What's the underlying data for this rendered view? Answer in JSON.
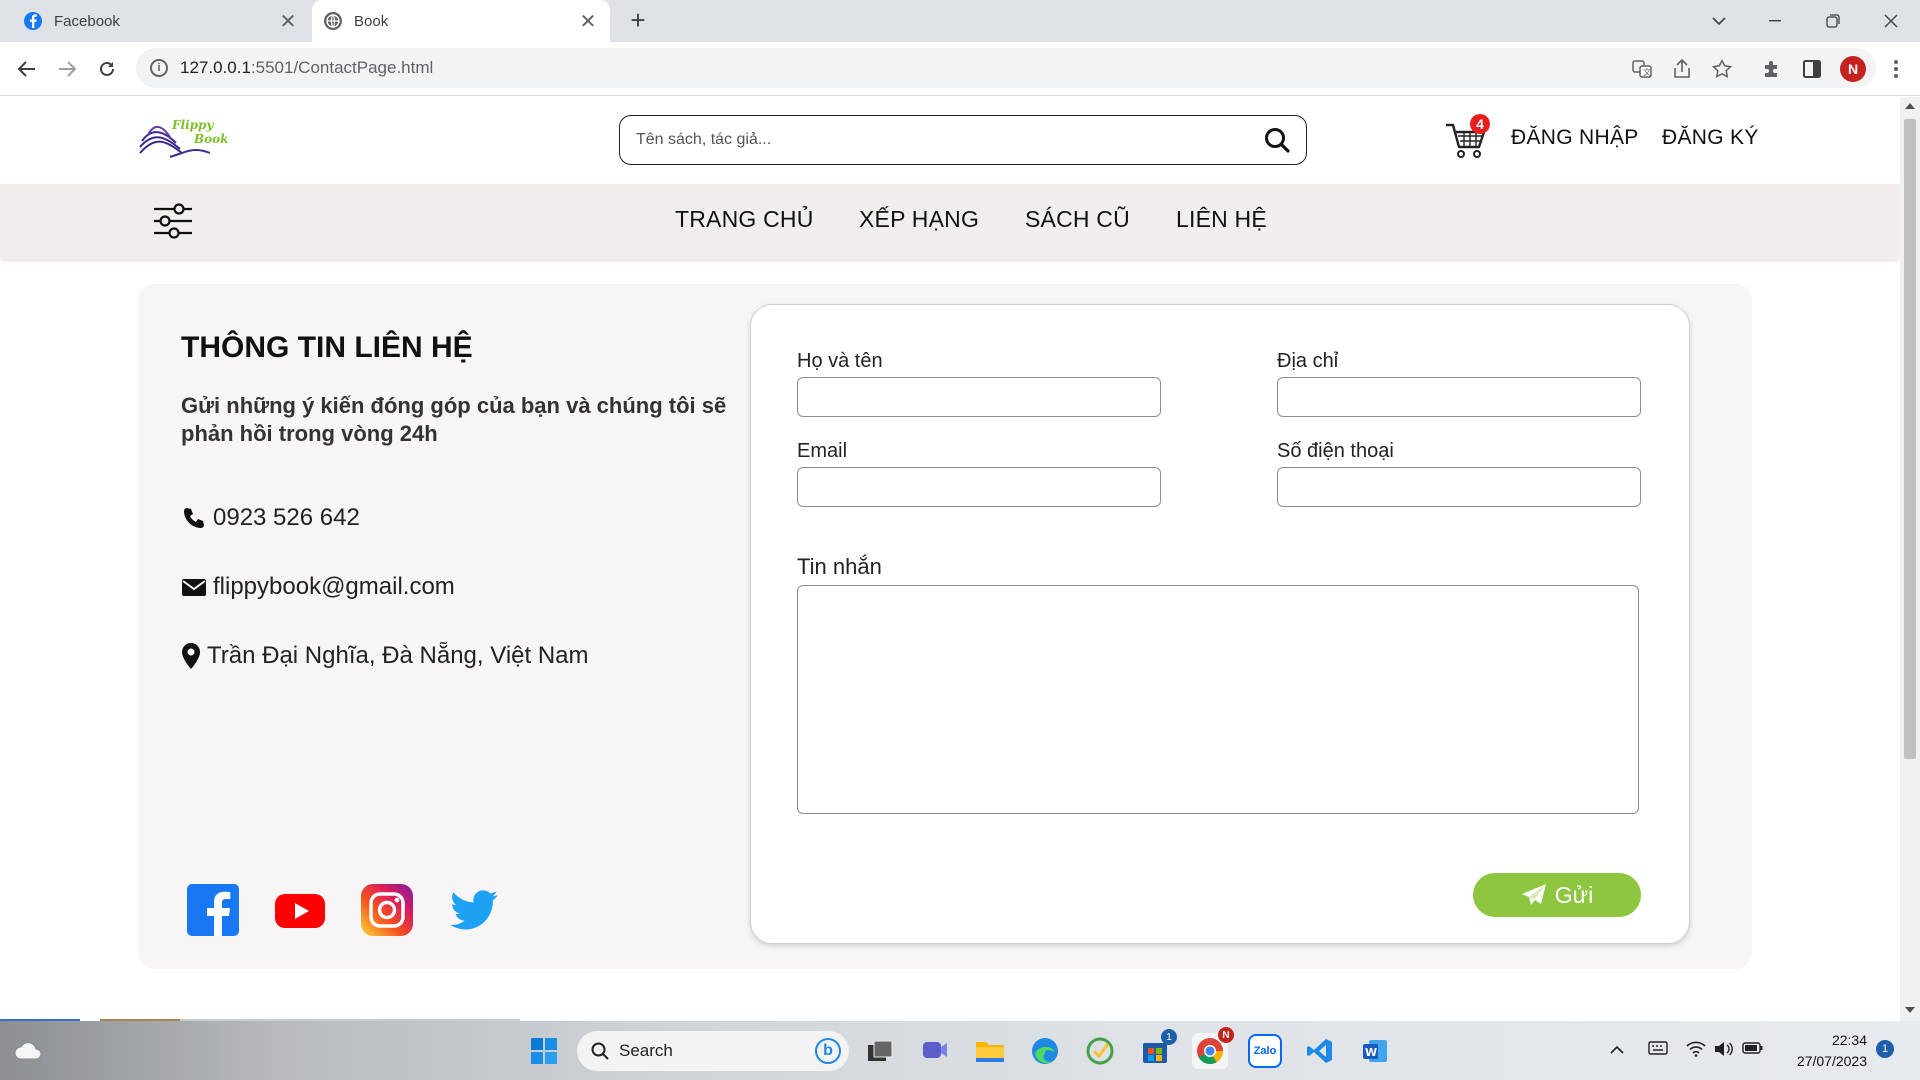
{
  "browser": {
    "tabs": [
      {
        "label": "Facebook",
        "close": "✕"
      },
      {
        "label": "Book",
        "close": "✕"
      }
    ],
    "new_tab": "+",
    "url_host": "127.0.0.1",
    "url_rest": ":5501/ContactPage.html",
    "profile_initial": "N"
  },
  "header": {
    "search_placeholder": "Tên sách, tác giả...",
    "cart_count": "4",
    "login": "ĐĂNG NHẬP",
    "register": "ĐĂNG KÝ",
    "logo_text": "Flippy Book"
  },
  "nav": {
    "items": [
      "TRANG CHỦ",
      "XẾP HẠNG",
      "SÁCH CŨ",
      "LIÊN HỆ"
    ]
  },
  "contact": {
    "title": "THÔNG TIN LIÊN HỆ",
    "description": "Gửi những ý kiến đóng góp của bạn và chúng tôi sẽ phản hồi trong vòng 24h",
    "phone": "0923 526 642",
    "email": "flippybook@gmail.com",
    "address": "Trần Đại Nghĩa, Đà Nẵng, Việt Nam"
  },
  "form": {
    "name_label": "Họ và tên",
    "address_label": "Địa chỉ",
    "email_label": "Email",
    "phone_label": "Số điện thoại",
    "message_label": "Tin nhắn",
    "send_label": "Gửi",
    "name_value": "",
    "address_value": "",
    "email_value": "",
    "phone_value": "",
    "message_value": ""
  },
  "taskbar": {
    "search_label": "Search",
    "time": "22:34",
    "date": "27/07/2023",
    "notifications": "1",
    "store_badge": "1",
    "chrome_badge": "N",
    "zalo_label": "Zalo"
  },
  "colors": {
    "accent_green": "#8ec63f",
    "nav_bg": "#f3eeee",
    "cart_badge": "#e51f1f"
  }
}
